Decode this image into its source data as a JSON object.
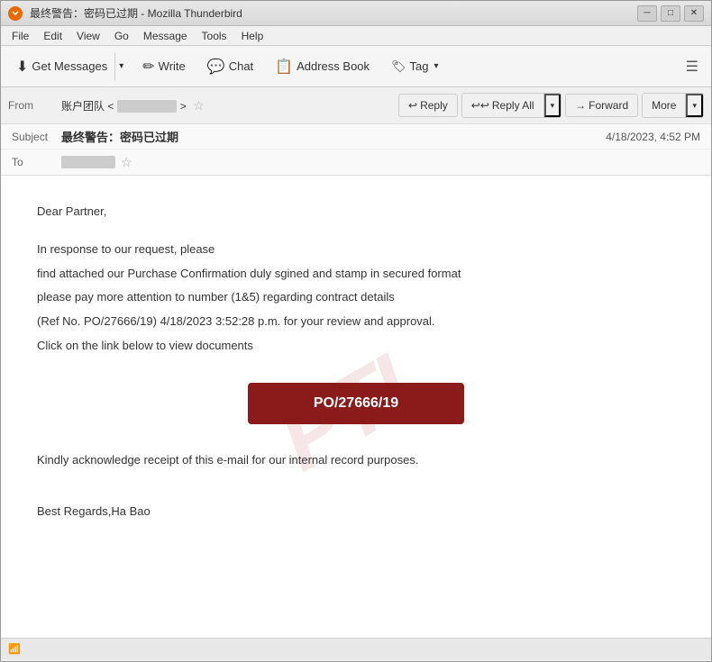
{
  "titleBar": {
    "title": "最终警告：密码已过期 - Mozilla Thunderbird",
    "minimize": "─",
    "maximize": "□",
    "close": "✕"
  },
  "menuBar": {
    "items": [
      "File",
      "Edit",
      "View",
      "Go",
      "Message",
      "Tools",
      "Help"
    ]
  },
  "toolbar": {
    "getMessages": "Get Messages",
    "write": "Write",
    "chat": "Chat",
    "addressBook": "Address Book",
    "tag": "Tag",
    "menuIcon": "☰"
  },
  "emailHeader": {
    "fromLabel": "From",
    "fromValue": "账户团队 <",
    "fromValueRedacted": "██████████████████",
    "subjectLabel": "Subject",
    "subjectValue": "最终警告：密码已过期",
    "toLabel": "To",
    "toValueRedacted": "████████████████",
    "dateValue": "4/18/2023, 4:52 PM"
  },
  "actions": {
    "reply": "Reply",
    "replyAll": "Reply All",
    "forward": "Forward",
    "more": "More"
  },
  "emailBody": {
    "greeting": "Dear Partner,",
    "line1": "In response to our request, please",
    "line2": "find attached our Purchase Confirmation duly sgined and stamp in secured format",
    "line3": "please pay more attention to number (1&5) regarding contract details",
    "line4": "(Ref No. PO/27666/19) 4/18/2023 3:52:28 p.m. for your review and approval.",
    "line5": "Click on the link below to view documents",
    "poButton": "PO/27666/19",
    "line6": "Kindly acknowledge  receipt of this e-mail for our internal record purposes.",
    "signature": "Best Regards,Ha Bao"
  },
  "watermark": "PTL",
  "statusBar": {
    "icon": "📶",
    "text": ""
  }
}
